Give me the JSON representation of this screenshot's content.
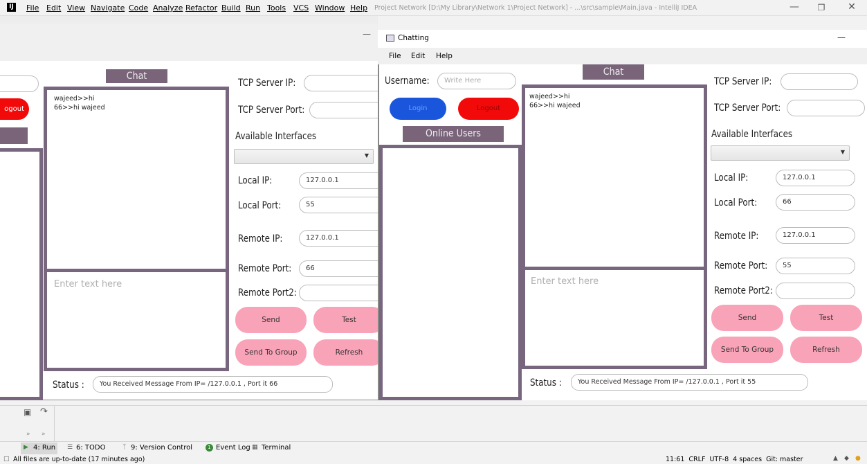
{
  "ide": {
    "menus": [
      "File",
      "Edit",
      "View",
      "Navigate",
      "Code",
      "Analyze",
      "Refactor",
      "Build",
      "Run",
      "Tools",
      "VCS",
      "Window",
      "Help"
    ],
    "title": "Project Network [D:\\My Library\\Network 1\\Project Network] - ...\\src\\sample\\Main.java - IntelliJ IDEA",
    "tool_tabs": [
      "4: Run",
      "6: TODO",
      "9: Version Control",
      "Event Log",
      "Terminal"
    ],
    "status_left": "All files are up-to-date (17 minutes ago)",
    "status_right": "11:61  CRLF  UTF-8  4 spaces  Git: master"
  },
  "back_window": {
    "logout_label": "ogout",
    "chat_header": "Chat",
    "messages": [
      "wajeed>>hi",
      "66>>hi wajeed"
    ],
    "input_placeholder": "Enter text here",
    "tcp_ip_label": "TCP Server IP:",
    "tcp_port_label": "TCP Server Port:",
    "interfaces_label": "Available Interfaces",
    "local_ip_label": "Local IP:",
    "local_ip": "127.0.0.1",
    "local_port_label": "Local Port:",
    "local_port": "55",
    "remote_ip_label": "Remote IP:",
    "remote_ip": "127.0.0.1",
    "remote_port_label": "Remote Port:",
    "remote_port": "66",
    "remote_port2_label": "Remote Port2:",
    "send": "Send",
    "test": "Test",
    "send_group": "Send To Group",
    "refresh": "Refresh",
    "status_label": "Status :",
    "status_text": "You Received Message From IP=  /127.0.0.1  , Port it 66"
  },
  "front_window": {
    "title": "Chatting",
    "menus": [
      "File",
      "Edit",
      "Help"
    ],
    "username_label": "Username:",
    "username_placeholder": "Write Here",
    "login": "Login",
    "logout": "Logout",
    "online_users": "Online Users",
    "chat_header": "Chat",
    "messages": [
      "wajeed>>hi",
      "66>>hi wajeed"
    ],
    "input_placeholder": "Enter text here",
    "tcp_ip_label": "TCP Server IP:",
    "tcp_port_label": "TCP Server Port:",
    "interfaces_label": "Available Interfaces",
    "local_ip_label": "Local IP:",
    "local_ip": "127.0.0.1",
    "local_port_label": "Local Port:",
    "local_port": "66",
    "remote_ip_label": "Remote IP:",
    "remote_ip": "127.0.0.1",
    "remote_port_label": "Remote Port:",
    "remote_port": "55",
    "remote_port2_label": "Remote Port2:",
    "send": "Send",
    "test": "Test",
    "send_group": "Send To Group",
    "refresh": "Refresh",
    "status_label": "Status :",
    "status_text": "You Received Message From IP=  /127.0.0.1  , Port it 55"
  },
  "colors": {
    "frame": "#78667f",
    "header": "#79647a",
    "pink": "#f9a3b8",
    "login_blue": "#1a56db",
    "logout_red": "#f20a0a"
  }
}
